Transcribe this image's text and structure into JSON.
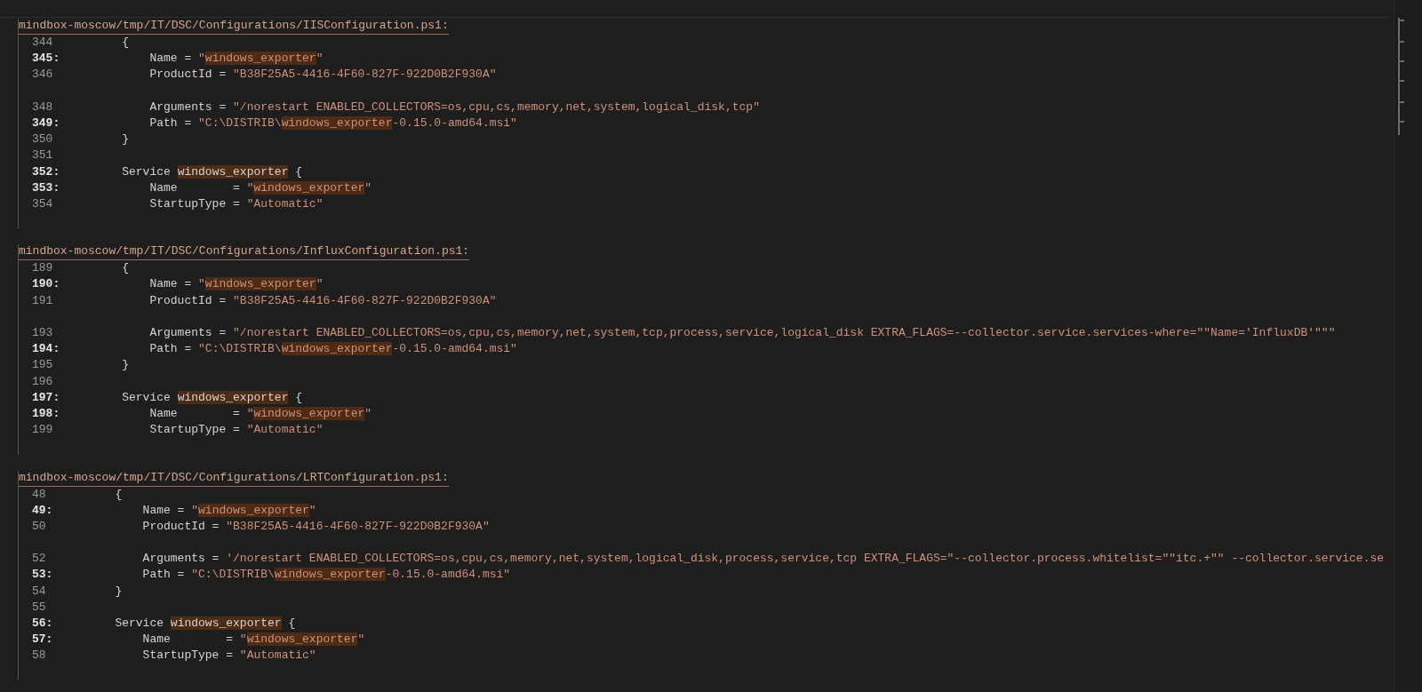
{
  "results": [
    {
      "path": "mindbox-moscow/tmp/IT/DSC/Configurations/IISConfiguration.ps1:",
      "lines": [
        {
          "kind": "code",
          "number": "344",
          "match": false,
          "segments": [
            {
              "kind": "plain",
              "text": "    {"
            }
          ]
        },
        {
          "kind": "code",
          "number": "345:",
          "match": true,
          "segments": [
            {
              "kind": "plain",
              "text": "        Name = "
            },
            {
              "kind": "string",
              "text": "\""
            },
            {
              "kind": "string-match",
              "text": "windows_exporter"
            },
            {
              "kind": "string",
              "text": "\""
            }
          ]
        },
        {
          "kind": "code",
          "number": "346",
          "match": false,
          "segments": [
            {
              "kind": "plain",
              "text": "        ProductId = "
            },
            {
              "kind": "string",
              "text": "\"B38F25A5-4416-4F60-827F-922D0B2F930A\""
            }
          ]
        },
        {
          "kind": "gap"
        },
        {
          "kind": "code",
          "number": "348",
          "match": false,
          "segments": [
            {
              "kind": "plain",
              "text": "        Arguments = "
            },
            {
              "kind": "string",
              "text": "\"/norestart ENABLED_COLLECTORS=os,cpu,cs,memory,net,system,logical_disk,tcp\""
            }
          ]
        },
        {
          "kind": "code",
          "number": "349:",
          "match": true,
          "segments": [
            {
              "kind": "plain",
              "text": "        Path = "
            },
            {
              "kind": "string",
              "text": "\"C:\\DISTRIB\\"
            },
            {
              "kind": "string-match",
              "text": "windows_exporter"
            },
            {
              "kind": "string",
              "text": "-0.15.0-amd64.msi\""
            }
          ]
        },
        {
          "kind": "code",
          "number": "350",
          "match": false,
          "segments": [
            {
              "kind": "plain",
              "text": "    }"
            }
          ]
        },
        {
          "kind": "code",
          "number": "351",
          "match": false
        },
        {
          "kind": "code",
          "number": "352:",
          "match": true,
          "segments": [
            {
              "kind": "plain",
              "text": "    Service "
            },
            {
              "kind": "plain-match",
              "text": "windows_exporter"
            },
            {
              "kind": "plain",
              "text": " {"
            }
          ]
        },
        {
          "kind": "code",
          "number": "353:",
          "match": true,
          "segments": [
            {
              "kind": "plain",
              "text": "        Name        = "
            },
            {
              "kind": "string",
              "text": "\""
            },
            {
              "kind": "string-match",
              "text": "windows_exporter"
            },
            {
              "kind": "string",
              "text": "\""
            }
          ]
        },
        {
          "kind": "code",
          "number": "354",
          "match": false,
          "segments": [
            {
              "kind": "plain",
              "text": "        StartupType = "
            },
            {
              "kind": "string",
              "text": "\"Automatic\""
            }
          ]
        }
      ]
    },
    {
      "path": "mindbox-moscow/tmp/IT/DSC/Configurations/InfluxConfiguration.ps1:",
      "lines": [
        {
          "kind": "code",
          "number": "189",
          "match": false,
          "segments": [
            {
              "kind": "plain",
              "text": "    {"
            }
          ]
        },
        {
          "kind": "code",
          "number": "190:",
          "match": true,
          "segments": [
            {
              "kind": "plain",
              "text": "        Name = "
            },
            {
              "kind": "string",
              "text": "\""
            },
            {
              "kind": "string-match",
              "text": "windows_exporter"
            },
            {
              "kind": "string",
              "text": "\""
            }
          ]
        },
        {
          "kind": "code",
          "number": "191",
          "match": false,
          "segments": [
            {
              "kind": "plain",
              "text": "        ProductId = "
            },
            {
              "kind": "string",
              "text": "\"B38F25A5-4416-4F60-827F-922D0B2F930A\""
            }
          ]
        },
        {
          "kind": "gap"
        },
        {
          "kind": "code",
          "number": "193",
          "match": false,
          "segments": [
            {
              "kind": "plain",
              "text": "        Arguments = "
            },
            {
              "kind": "string",
              "text": "\"/norestart ENABLED_COLLECTORS=os,cpu,cs,memory,net,system,tcp,process,service,logical_disk EXTRA_FLAGS=--collector.service.services-where=\"\"Name='InfluxDB'\"\"\""
            }
          ]
        },
        {
          "kind": "code",
          "number": "194:",
          "match": true,
          "segments": [
            {
              "kind": "plain",
              "text": "        Path = "
            },
            {
              "kind": "string",
              "text": "\"C:\\DISTRIB\\"
            },
            {
              "kind": "string-match",
              "text": "windows_exporter"
            },
            {
              "kind": "string",
              "text": "-0.15.0-amd64.msi\""
            }
          ]
        },
        {
          "kind": "code",
          "number": "195",
          "match": false,
          "segments": [
            {
              "kind": "plain",
              "text": "    }"
            }
          ]
        },
        {
          "kind": "code",
          "number": "196",
          "match": false
        },
        {
          "kind": "code",
          "number": "197:",
          "match": true,
          "segments": [
            {
              "kind": "plain",
              "text": "    Service "
            },
            {
              "kind": "plain-match",
              "text": "windows_exporter"
            },
            {
              "kind": "plain",
              "text": " {"
            }
          ]
        },
        {
          "kind": "code",
          "number": "198:",
          "match": true,
          "segments": [
            {
              "kind": "plain",
              "text": "        Name        = "
            },
            {
              "kind": "string",
              "text": "\""
            },
            {
              "kind": "string-match",
              "text": "windows_exporter"
            },
            {
              "kind": "string",
              "text": "\""
            }
          ]
        },
        {
          "kind": "code",
          "number": "199",
          "match": false,
          "segments": [
            {
              "kind": "plain",
              "text": "        StartupType = "
            },
            {
              "kind": "string",
              "text": "\"Automatic\""
            }
          ]
        }
      ]
    },
    {
      "path": "mindbox-moscow/tmp/IT/DSC/Configurations/LRTConfiguration.ps1:",
      "lines": [
        {
          "kind": "code",
          "number": "48",
          "match": false,
          "segments": [
            {
              "kind": "plain",
              "text": "   {"
            }
          ]
        },
        {
          "kind": "code",
          "number": "49:",
          "match": true,
          "segments": [
            {
              "kind": "plain",
              "text": "       Name = "
            },
            {
              "kind": "string",
              "text": "\""
            },
            {
              "kind": "string-match",
              "text": "windows_exporter"
            },
            {
              "kind": "string",
              "text": "\""
            }
          ]
        },
        {
          "kind": "code",
          "number": "50",
          "match": false,
          "segments": [
            {
              "kind": "plain",
              "text": "       ProductId = "
            },
            {
              "kind": "string",
              "text": "\"B38F25A5-4416-4F60-827F-922D0B2F930A\""
            }
          ]
        },
        {
          "kind": "gap"
        },
        {
          "kind": "code",
          "number": "52",
          "match": false,
          "segments": [
            {
              "kind": "plain",
              "text": "       Arguments = "
            },
            {
              "kind": "string",
              "text": "'/norestart ENABLED_COLLECTORS=os,cpu,cs,memory,net,system,logical_disk,process,service,tcp EXTRA_FLAGS=\"--collector.process.whitelist=\"\"itc.+\"\" --collector.service.se"
            }
          ]
        },
        {
          "kind": "code",
          "number": "53:",
          "match": true,
          "segments": [
            {
              "kind": "plain",
              "text": "       Path = "
            },
            {
              "kind": "string",
              "text": "\"C:\\DISTRIB\\"
            },
            {
              "kind": "string-match",
              "text": "windows_exporter"
            },
            {
              "kind": "string",
              "text": "-0.15.0-amd64.msi\""
            }
          ]
        },
        {
          "kind": "code",
          "number": "54",
          "match": false,
          "segments": [
            {
              "kind": "plain",
              "text": "   }"
            }
          ]
        },
        {
          "kind": "code",
          "number": "55",
          "match": false
        },
        {
          "kind": "code",
          "number": "56:",
          "match": true,
          "segments": [
            {
              "kind": "plain",
              "text": "   Service "
            },
            {
              "kind": "plain-match",
              "text": "windows_exporter"
            },
            {
              "kind": "plain",
              "text": " {"
            }
          ]
        },
        {
          "kind": "code",
          "number": "57:",
          "match": true,
          "segments": [
            {
              "kind": "plain",
              "text": "       Name        = "
            },
            {
              "kind": "string",
              "text": "\""
            },
            {
              "kind": "string-match",
              "text": "windows_exporter"
            },
            {
              "kind": "string",
              "text": "\""
            }
          ]
        },
        {
          "kind": "code",
          "number": "58",
          "match": false,
          "segments": [
            {
              "kind": "plain",
              "text": "       StartupType = "
            },
            {
              "kind": "string",
              "text": "\"Automatic\""
            }
          ]
        }
      ]
    }
  ]
}
